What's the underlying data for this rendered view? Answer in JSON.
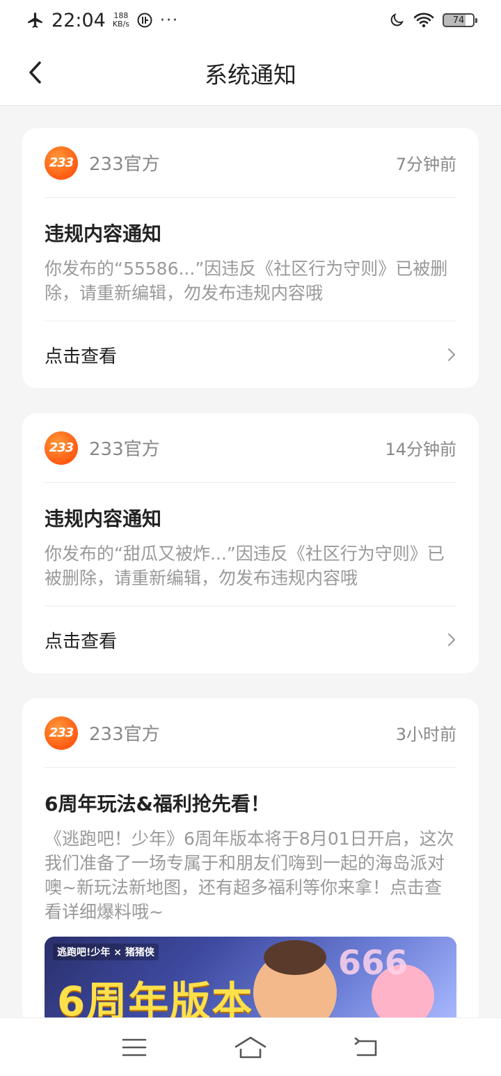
{
  "status_bar": {
    "time": "22:04",
    "speed_value": "188",
    "speed_unit": "KB/s",
    "more": "···",
    "battery": "74"
  },
  "header": {
    "title": "系统通知"
  },
  "notifications": [
    {
      "sender": "233官方",
      "logo": "233",
      "time": "7分钟前",
      "title": "违规内容通知",
      "text": "你发布的“55586...”因违反《社区行为守则》已被删除，请重新编辑，勿发布违规内容哦",
      "action": "点击查看"
    },
    {
      "sender": "233官方",
      "logo": "233",
      "time": "14分钟前",
      "title": "违规内容通知",
      "text": "你发布的“甜瓜又被炸...”因违反《社区行为守则》已被删除，请重新编辑，勿发布违规内容哦",
      "action": "点击查看"
    },
    {
      "sender": "233官方",
      "logo": "233",
      "time": "3小时前",
      "title": "6周年玩法&福利抢先看！",
      "text": "《逃跑吧！少年》6周年版本将于8月01日开启，这次我们准备了一场专属于和朋友们嗨到一起的海岛派对噢~新玩法新地图，还有超多福利等你来拿！点击查看详细爆料哦~",
      "banner_tag": "逃跑吧!少年 × 猪猪侠",
      "banner_text": "6周年版本",
      "banner_number": "666"
    }
  ],
  "icons": {
    "back": "chevron-left-icon",
    "arrow": "chevron-right-icon",
    "menu": "menu-icon",
    "home": "home-icon",
    "return": "return-icon"
  }
}
